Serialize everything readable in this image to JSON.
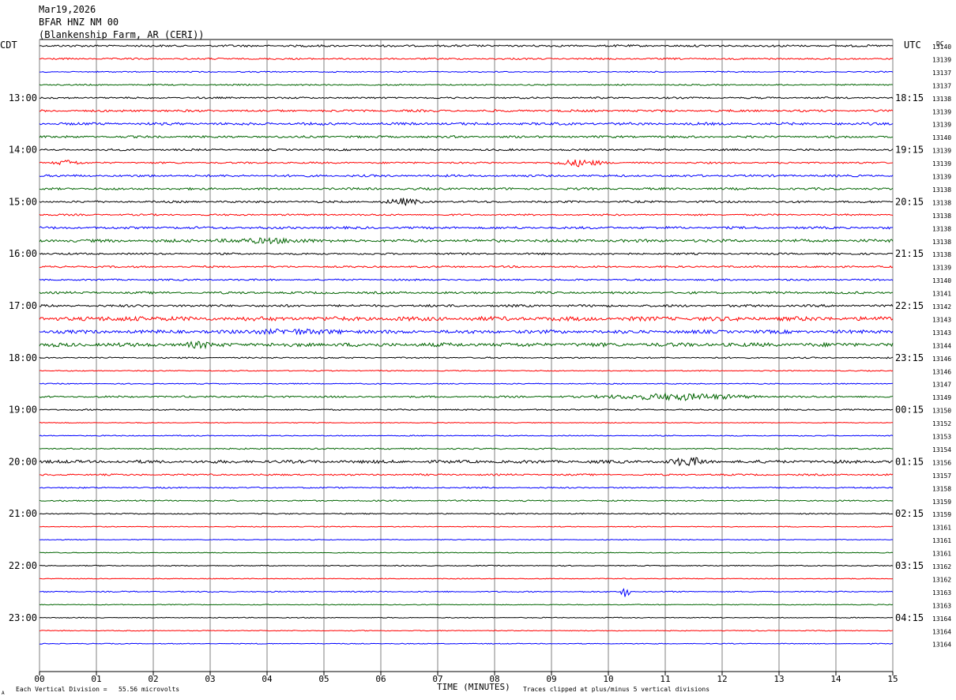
{
  "header": {
    "date": "Mar19,2026",
    "station": "BFAR HNZ NM 00",
    "location": "(Blankenship Farm, AR (CERI))"
  },
  "left_timezone": "CDT",
  "right_timezone": "UTC",
  "dc_label": "DC",
  "footer": {
    "scale_note": "Each Vertical Division =   55.56 microvolts",
    "xlabel": "TIME (MINUTES)",
    "clip_note": "Traces clipped at plus/minus 5 vertical divisions",
    "corner_mark": "A"
  },
  "colors": {
    "trace_cycle": [
      "#000000",
      "#ff0000",
      "#0000ff",
      "#006400"
    ],
    "grid": "#808080"
  },
  "chart_data": {
    "type": "line",
    "title": "BFAR HNZ NM 00",
    "xlabel": "TIME (MINUTES)",
    "xlim": [
      0,
      15
    ],
    "x_ticks": [
      "00",
      "01",
      "02",
      "03",
      "04",
      "05",
      "06",
      "07",
      "08",
      "09",
      "10",
      "11",
      "12",
      "13",
      "14",
      "15"
    ],
    "left_hour_labels": [
      "13:00",
      "14:00",
      "15:00",
      "16:00",
      "17:00",
      "18:00",
      "19:00",
      "20:00",
      "21:00",
      "22:00",
      "23:00"
    ],
    "right_hour_labels": [
      "18:15",
      "19:15",
      "20:15",
      "21:15",
      "22:15",
      "23:15",
      "00:15",
      "01:15",
      "02:15",
      "03:15",
      "04:15"
    ],
    "dc_values": [
      "13140",
      "13139",
      "13137",
      "13137",
      "13138",
      "13139",
      "13139",
      "13140",
      "13139",
      "13139",
      "13139",
      "13138",
      "13138",
      "13138",
      "13138",
      "13138",
      "13138",
      "13139",
      "13140",
      "13141",
      "13142",
      "13143",
      "13143",
      "13144",
      "13146",
      "13146",
      "13147",
      "13149",
      "13150",
      "13152",
      "13153",
      "13154",
      "13156",
      "13157",
      "13158",
      "13159",
      "13159",
      "13161",
      "13161",
      "13161",
      "13162",
      "13162",
      "13163",
      "13163",
      "13164",
      "13164",
      "13164"
    ],
    "amplitude": [
      1.2,
      1,
      0.7,
      0.8,
      1,
      1.3,
      1.5,
      1.3,
      1.1,
      1,
      1.3,
      1.3,
      1.2,
      1,
      1.4,
      1.7,
      1.1,
      1.1,
      1,
      1.3,
      1.4,
      2.5,
      2,
      2.3,
      0.8,
      0.6,
      0.6,
      1.1,
      0.8,
      0.5,
      0.6,
      0.8,
      1.8,
      1,
      0.8,
      0.8,
      0.7,
      0.5,
      0.5,
      0.5,
      0.6,
      0.5,
      0.7,
      0.5,
      0.5,
      0.5,
      0.5
    ],
    "events": [
      {
        "trace": 9,
        "minute": 0.5,
        "width": 0.3,
        "amp": 4
      },
      {
        "trace": 9,
        "minute": 9.5,
        "width": 0.5,
        "amp": 5
      },
      {
        "trace": 12,
        "minute": 6.4,
        "width": 0.4,
        "amp": 5
      },
      {
        "trace": 15,
        "minute": 4.0,
        "width": 1.2,
        "amp": 4
      },
      {
        "trace": 21,
        "minute": 1.5,
        "width": 2.5,
        "amp": 3
      },
      {
        "trace": 22,
        "minute": 4.5,
        "width": 1.5,
        "amp": 4
      },
      {
        "trace": 23,
        "minute": 2.8,
        "width": 0.4,
        "amp": 5
      },
      {
        "trace": 27,
        "minute": 11.2,
        "width": 1.5,
        "amp": 5
      },
      {
        "trace": 32,
        "minute": 11.4,
        "width": 0.4,
        "amp": 7
      },
      {
        "trace": 42,
        "minute": 10.3,
        "width": 0.08,
        "amp": 9
      }
    ]
  }
}
